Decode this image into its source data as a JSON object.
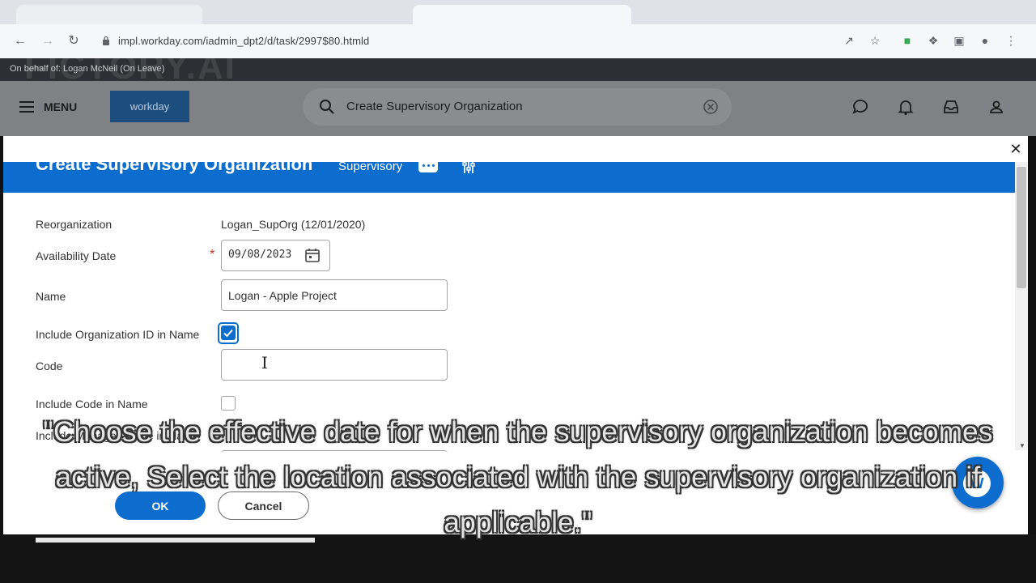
{
  "browser": {
    "url": "impl.workday.com/iadmin_dpt2/d/task/2997$80.htmld"
  },
  "workday": {
    "on_behalf": "On behalf of: Logan McNeil (On Leave)",
    "watermark": "FICTORY.AI",
    "menu_label": "MENU",
    "logo_text": "workday",
    "search_value": "Create Supervisory Organization"
  },
  "modal": {
    "title": "Create Supervisory Organization",
    "chip": "Supervisory",
    "fields": {
      "reorganization": {
        "label": "Reorganization",
        "value": "Logan_SupOrg (12/01/2020)"
      },
      "availability_date": {
        "label": "Availability Date",
        "value": "09/08/2023",
        "required_mark": "*"
      },
      "name": {
        "label": "Name",
        "value": "Logan - Apple Project"
      },
      "include_org_id": {
        "label": "Include Organization ID in Name",
        "checked": true
      },
      "code": {
        "label": "Code",
        "value": ""
      },
      "include_code": {
        "label": "Include Code in Name",
        "checked": false
      },
      "include_manager": {
        "label": "Include Manager Name in Name"
      }
    },
    "ok_label": "OK",
    "cancel_label": "Cancel"
  },
  "caption": "\"Choose the effective date for when the supervisory organization becomes active, Select the location associated with the supervisory organization if applicable.\"",
  "colors": {
    "workday_blue": "#0d6dce",
    "required_red": "#de2e21"
  },
  "icons": [
    "lock-icon",
    "search-icon",
    "clear-icon",
    "chat-icon",
    "bell-icon",
    "inbox-icon",
    "profile-icon",
    "calendar-icon",
    "related-actions-icon",
    "close-icon",
    "help-icon"
  ]
}
